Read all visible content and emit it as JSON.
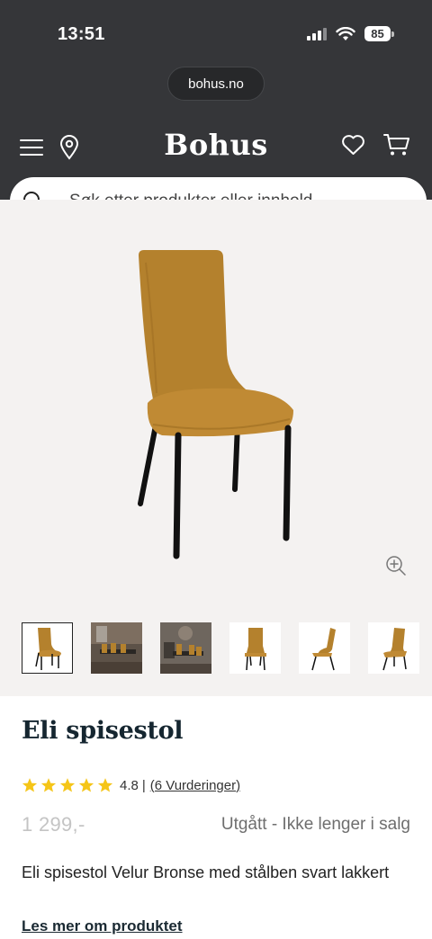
{
  "status_bar": {
    "time": "13:51",
    "battery": "85"
  },
  "browser": {
    "url": "bohus.no"
  },
  "header": {
    "brand": "Bohus"
  },
  "search": {
    "placeholder": "Søk etter produkter eller innhold..."
  },
  "gallery": {
    "thumbnails": [
      "chair-front",
      "room-scene-1",
      "room-scene-2",
      "chair-front-2",
      "chair-side",
      "chair-angle"
    ],
    "active_index": 0
  },
  "product": {
    "title": "Eli spisestol",
    "rating": {
      "stars": 5,
      "score": "4.8",
      "separator": "|",
      "reviews_label": "(6 Vurderinger)"
    },
    "price": "1 299,-",
    "availability": "Utgått - Ikke lenger i salg",
    "description": "Eli spisestol Velur Bronse med stålben svart lakkert",
    "read_more": "Les mer om produktet"
  },
  "colors": {
    "header_bg": "#353639",
    "star": "#f5c518",
    "hero_bg": "#f4f2f1",
    "chair": "#b5822e"
  }
}
